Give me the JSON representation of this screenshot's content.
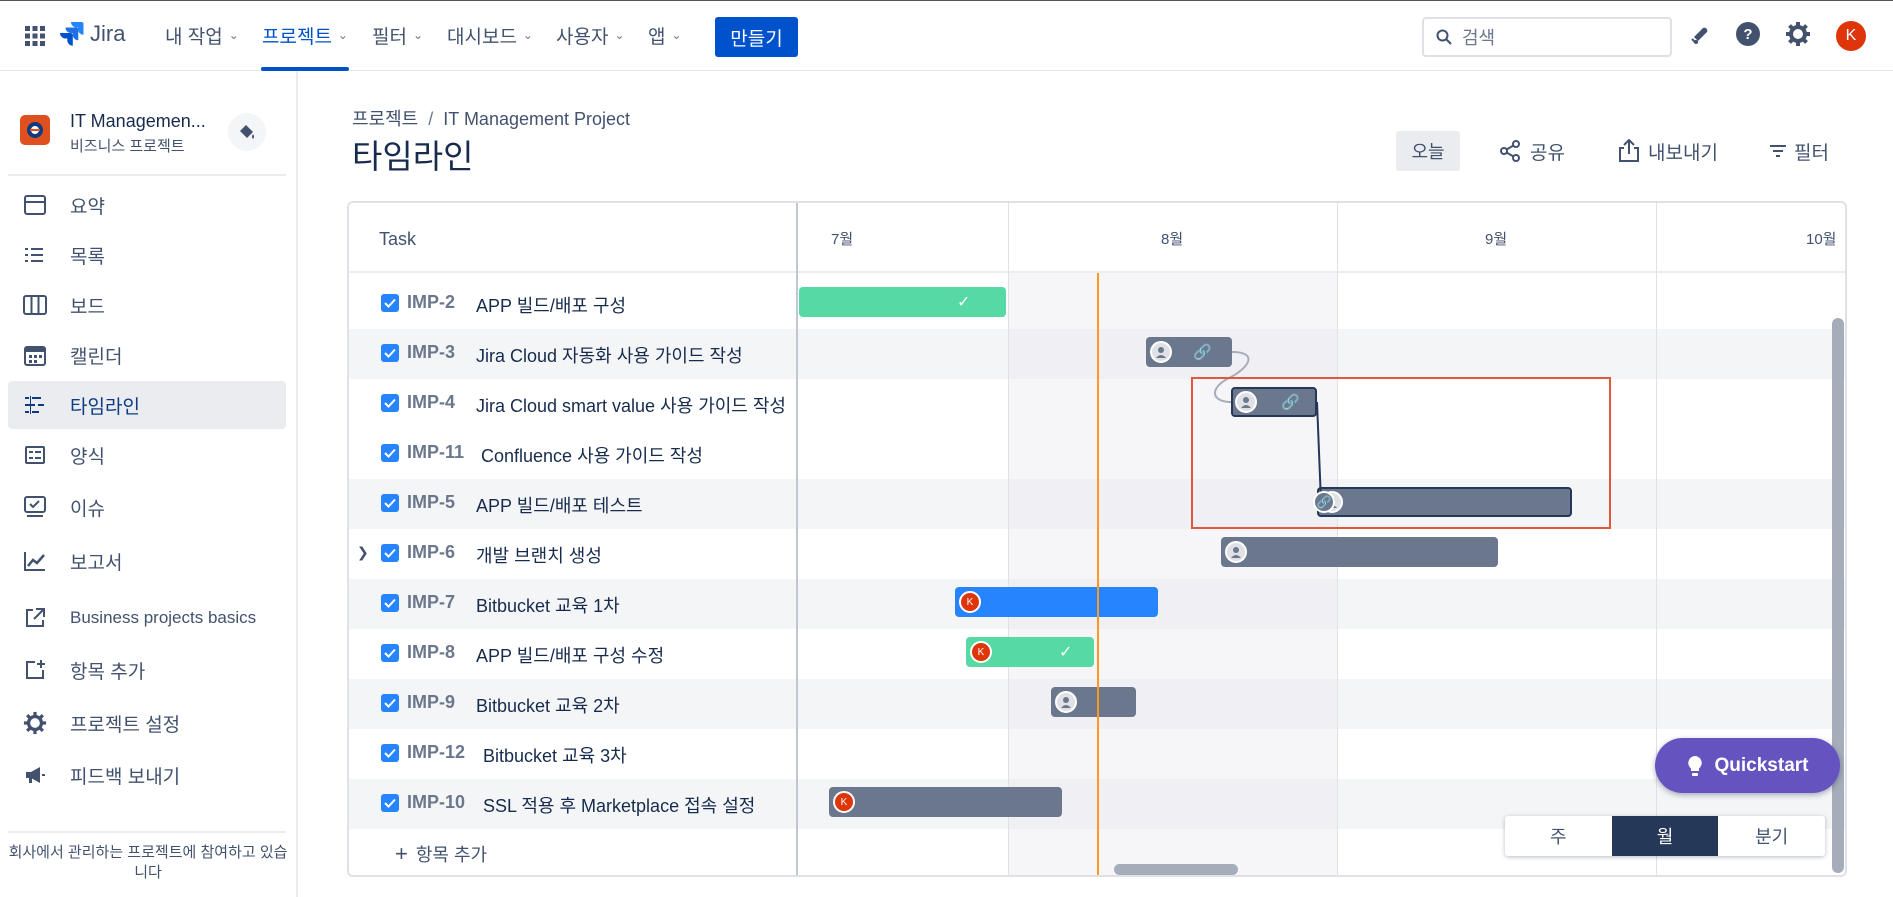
{
  "topbar": {
    "product": "Jira",
    "nav": [
      {
        "label": "내 작업"
      },
      {
        "label": "프로젝트"
      },
      {
        "label": "필터"
      },
      {
        "label": "대시보드"
      },
      {
        "label": "사용자"
      },
      {
        "label": "앱"
      }
    ],
    "active_nav": "프로젝트",
    "create_label": "만들기",
    "search_placeholder": "검색",
    "user_initial": "K",
    "icons": [
      "app-switcher-icon",
      "notifications-icon",
      "help-icon",
      "settings-icon"
    ]
  },
  "sidebar": {
    "project_name": "IT Managemen...",
    "project_type": "비즈니스 프로젝트",
    "items": [
      {
        "label": "요약",
        "icon": "summary-icon"
      },
      {
        "label": "목록",
        "icon": "list-icon"
      },
      {
        "label": "보드",
        "icon": "board-icon"
      },
      {
        "label": "캘린더",
        "icon": "calendar-icon"
      },
      {
        "label": "타임라인",
        "icon": "timeline-icon"
      },
      {
        "label": "양식",
        "icon": "forms-icon"
      },
      {
        "label": "이슈",
        "icon": "issues-icon"
      },
      {
        "label": "보고서",
        "icon": "reports-icon"
      },
      {
        "label": "Business projects basics",
        "icon": "external-link-icon"
      },
      {
        "label": "항목 추가",
        "icon": "add-item-icon"
      },
      {
        "label": "프로젝트 설정",
        "icon": "gear-icon"
      },
      {
        "label": "피드백 보내기",
        "icon": "megaphone-icon"
      }
    ],
    "active_item": "타임라인",
    "footer": "회사에서 관리하는 프로젝트에 참여하고 있습니다"
  },
  "page": {
    "breadcrumb": [
      "프로젝트",
      "IT Management Project"
    ],
    "title": "타임라인",
    "actions": {
      "today": "오늘",
      "share": "공유",
      "export": "내보내기",
      "filter": "필터"
    }
  },
  "timeline": {
    "task_header": "Task",
    "months": [
      "7월",
      "8월",
      "9월",
      "10월"
    ],
    "rows": [
      {
        "key": "IMP-2",
        "summary": "APP 빌드/배포 구성",
        "done": true
      },
      {
        "key": "IMP-3",
        "summary": "Jira Cloud 자동화 사용 가이드 작성",
        "done": true
      },
      {
        "key": "IMP-4",
        "summary": "Jira Cloud smart value 사용 가이드 작성",
        "done": true
      },
      {
        "key": "IMP-11",
        "summary": "Confluence 사용 가이드 작성",
        "done": true
      },
      {
        "key": "IMP-5",
        "summary": "APP 빌드/배포 테스트",
        "done": true
      },
      {
        "key": "IMP-6",
        "summary": "개발 브랜치 생성",
        "done": true,
        "expandable": true
      },
      {
        "key": "IMP-7",
        "summary": "Bitbucket 교육 1차",
        "done": true
      },
      {
        "key": "IMP-8",
        "summary": "APP 빌드/배포 구성 수정",
        "done": true
      },
      {
        "key": "IMP-9",
        "summary": "Bitbucket 교육 2차",
        "done": true
      },
      {
        "key": "IMP-12",
        "summary": "Bitbucket 교육 3차",
        "done": true
      },
      {
        "key": "IMP-10",
        "summary": "SSL 적용 후 Marketplace 접속 설정",
        "done": true
      }
    ],
    "bar_colors": {
      "grey": "#6b778c",
      "green": "#57d9a3",
      "blue": "#2684ff"
    },
    "add_item": "항목 추가",
    "today_color": "#ff991f"
  },
  "zoom": {
    "options": [
      "주",
      "월",
      "분기"
    ],
    "selected": "월"
  },
  "quickstart": "Quickstart",
  "avatar_initial": "K"
}
